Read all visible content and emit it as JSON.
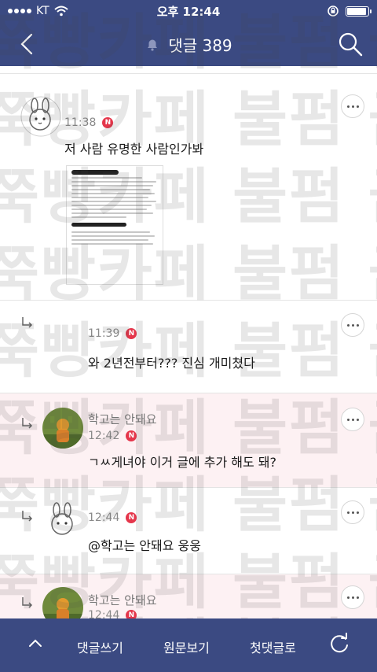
{
  "status": {
    "carrier": "KT",
    "time": "오후 12:44"
  },
  "header": {
    "title": "댓글 389"
  },
  "comments": [
    {
      "name": "",
      "time": "11:38",
      "text": "저 사람 유명한 사람인가봐",
      "reply": false,
      "badge": "N"
    },
    {
      "name": "",
      "time": "11:39",
      "text": "와 2년전부터??? 진심 개미쳤다",
      "reply": true,
      "badge": "N"
    },
    {
      "name": "학고는 안돼요",
      "time": "12:42",
      "text": "ㄱㅆ게녀야 이거 글에 추가 해도 돼?",
      "reply": true,
      "badge": "N"
    },
    {
      "name": "",
      "time": "12:44",
      "text": "@학고는 안돼요  웅웅",
      "reply": true,
      "badge": "N"
    },
    {
      "name": "학고는 안돼요",
      "time": "12:44",
      "text": "",
      "reply": true,
      "badge": "N"
    }
  ],
  "watermark": {
    "text": "쭉빵카페 불펌 금지"
  },
  "bottom": {
    "write": "댓글쓰기",
    "original": "원문보기",
    "first": "첫댓글로"
  },
  "colors": {
    "nav_bg": "#3b4a82",
    "badge": "#e5364b",
    "reply_bg": "#fdf1f3"
  }
}
